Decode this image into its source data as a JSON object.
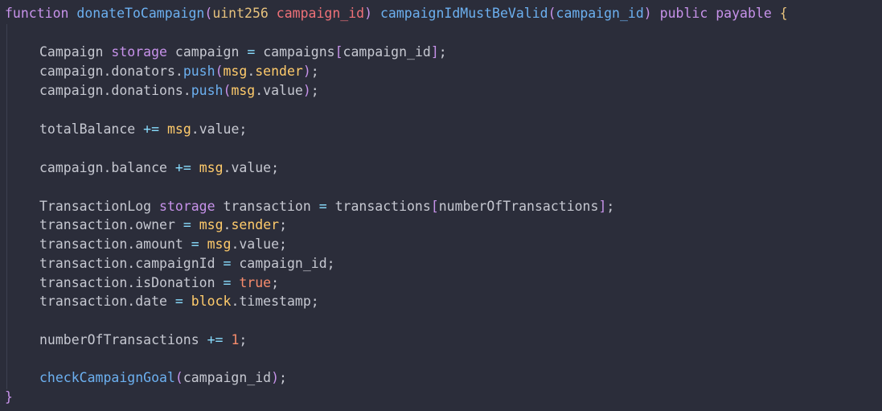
{
  "code": {
    "line_01": {
      "kw_function": "function",
      "fn_name": "donateToCampaign",
      "paren_open": "(",
      "param_type": "uint256",
      "param_name": "campaign_id",
      "paren_close": ")",
      "modifier_name": "campaignIdMustBeValid",
      "modifier_open": "(",
      "modifier_arg": "campaign_id",
      "modifier_close": ")",
      "kw_public": "public",
      "kw_payable": "payable",
      "brace_open": "{"
    },
    "line_03": {
      "type": "Campaign",
      "kw_storage": "storage",
      "var": "campaign",
      "op": "=",
      "src": "campaigns",
      "br_open": "[",
      "idx": "campaign_id",
      "br_close": "]",
      "semi": ";"
    },
    "line_04": {
      "obj": "campaign.donators.",
      "method": "push",
      "po": "(",
      "msg": "msg",
      "dot": ".",
      "prop": "sender",
      "pc": ")",
      "semi": ";"
    },
    "line_05": {
      "obj": "campaign.donations.",
      "method": "push",
      "po": "(",
      "msg": "msg",
      "rest": ".value",
      "pc": ")",
      "semi": ";"
    },
    "line_07": {
      "var": "totalBalance",
      "op": "+=",
      "msg": "msg",
      "rest": ".value;"
    },
    "line_09": {
      "var": "campaign.balance",
      "op": "+=",
      "msg": "msg",
      "rest": ".value;"
    },
    "line_11": {
      "type": "TransactionLog",
      "kw_storage": "storage",
      "var": "transaction",
      "op": "=",
      "src": "transactions",
      "br_open": "[",
      "idx": "numberOfTransactions",
      "br_close": "]",
      "semi": ";"
    },
    "line_12": {
      "lhs": "transaction.owner",
      "op": "=",
      "msg": "msg",
      "dot": ".",
      "prop": "sender",
      "semi": ";"
    },
    "line_13": {
      "lhs": "transaction.amount",
      "op": "=",
      "msg": "msg",
      "rest": ".value;"
    },
    "line_14": {
      "lhs": "transaction.campaignId",
      "op": "=",
      "rhs": "campaign_id;"
    },
    "line_15": {
      "lhs": "transaction.isDonation",
      "op": "=",
      "bool": "true",
      "semi": ";"
    },
    "line_16": {
      "lhs": "transaction.date",
      "op": "=",
      "block": "block",
      "rest": ".timestamp;"
    },
    "line_18": {
      "var": "numberOfTransactions",
      "op": "+=",
      "num": "1",
      "semi": ";"
    },
    "line_20": {
      "fn": "checkCampaignGoal",
      "po": "(",
      "arg": "campaign_id",
      "pc": ")",
      "semi": ";"
    },
    "line_21": {
      "brace_close": "}"
    }
  },
  "colors": {
    "background": "#2b2d3a",
    "keyword": "#c792ea",
    "function": "#6cb0f0",
    "type": "#e7c27d",
    "param": "#f07178",
    "operator": "#89ddff",
    "global": "#ffcb6b",
    "number": "#f78c6c",
    "text": "#c6c8d1"
  }
}
